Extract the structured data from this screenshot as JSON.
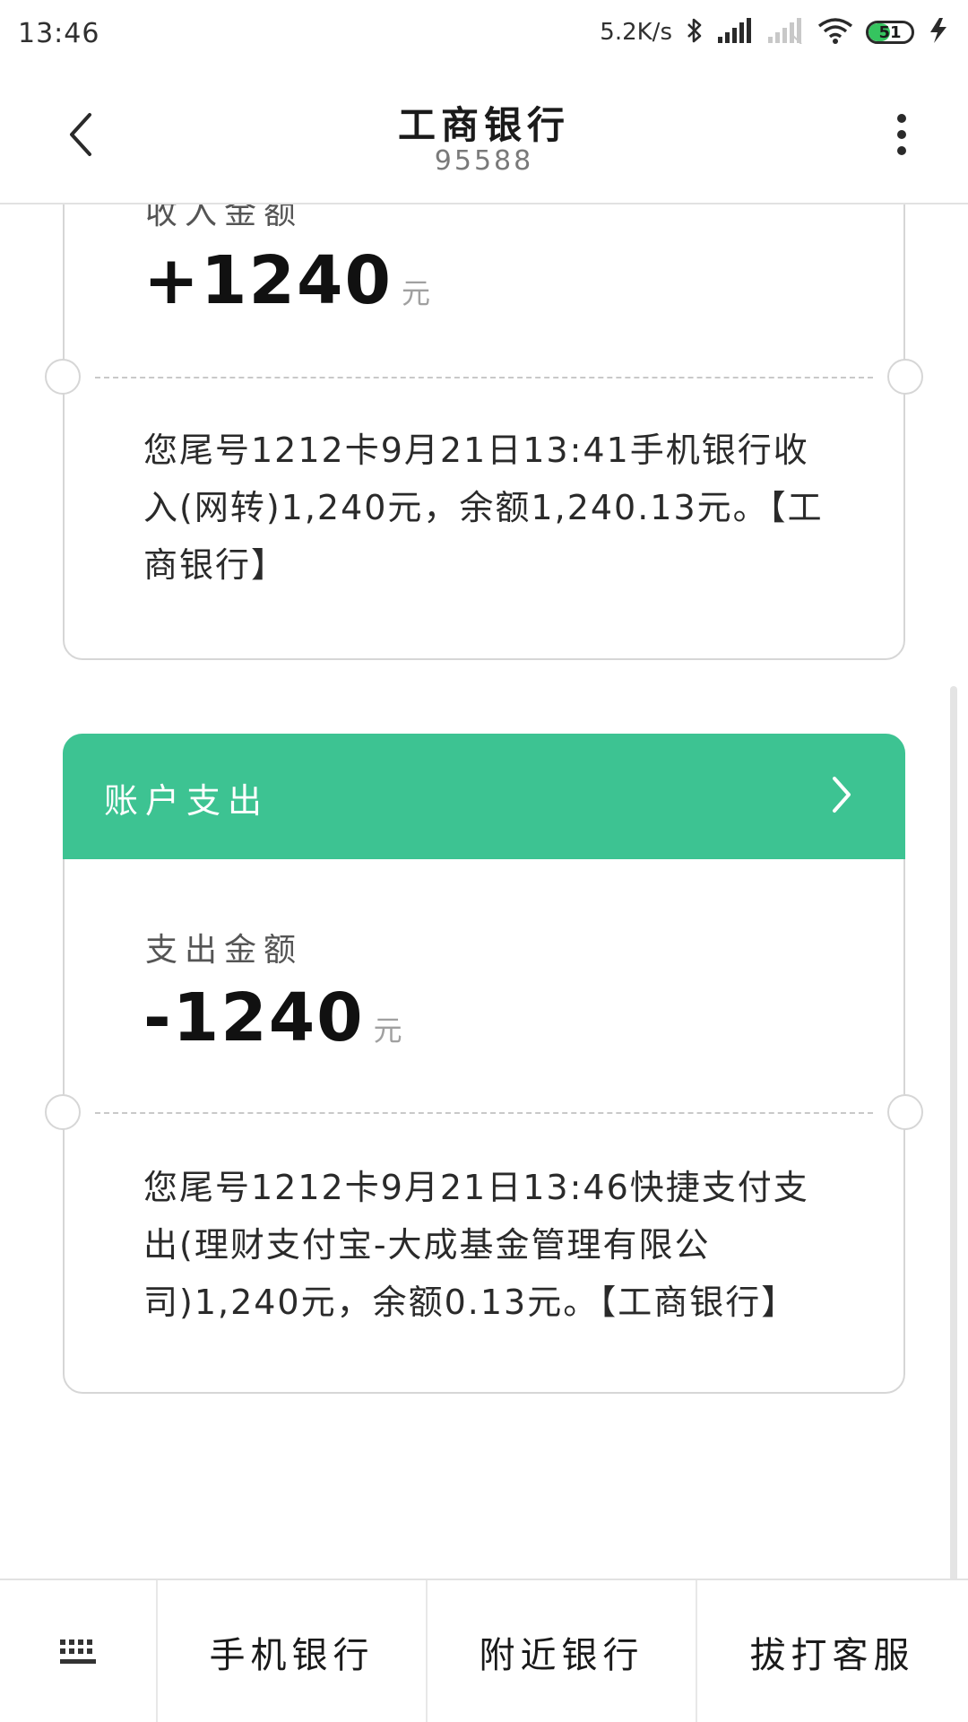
{
  "status_bar": {
    "time": "13:46",
    "net_speed": "5.2K/s",
    "battery_level": "51",
    "icons": [
      "bluetooth-icon",
      "signal-icon",
      "signal-weak-icon",
      "wifi-icon",
      "battery-icon",
      "charging-icon"
    ]
  },
  "header": {
    "title": "工商银行",
    "subtitle": "95588",
    "icons": [
      "back-icon",
      "more-icon"
    ]
  },
  "cards": [
    {
      "label": "收入金额",
      "amount": "+1240",
      "unit": "元",
      "message": "您尾号1212卡9月21日13:41手机银行收入(网转)1,240元，余额1,240.13元。【工商银行】"
    },
    {
      "header_title": "账户支出",
      "label": "支出金额",
      "amount": "-1240",
      "unit": "元",
      "message": "您尾号1212卡9月21日13:46快捷支付支出(理财支付宝-大成基金管理有限公司)1,240元，余额0.13元。【工商银行】"
    }
  ],
  "bottom_bar": {
    "keyboard_icon": "keyboard-icon",
    "items": [
      "手机银行",
      "附近银行",
      "拔打客服"
    ]
  },
  "colors": {
    "accent": "#3dc392",
    "battery_fill": "#35c45f"
  }
}
